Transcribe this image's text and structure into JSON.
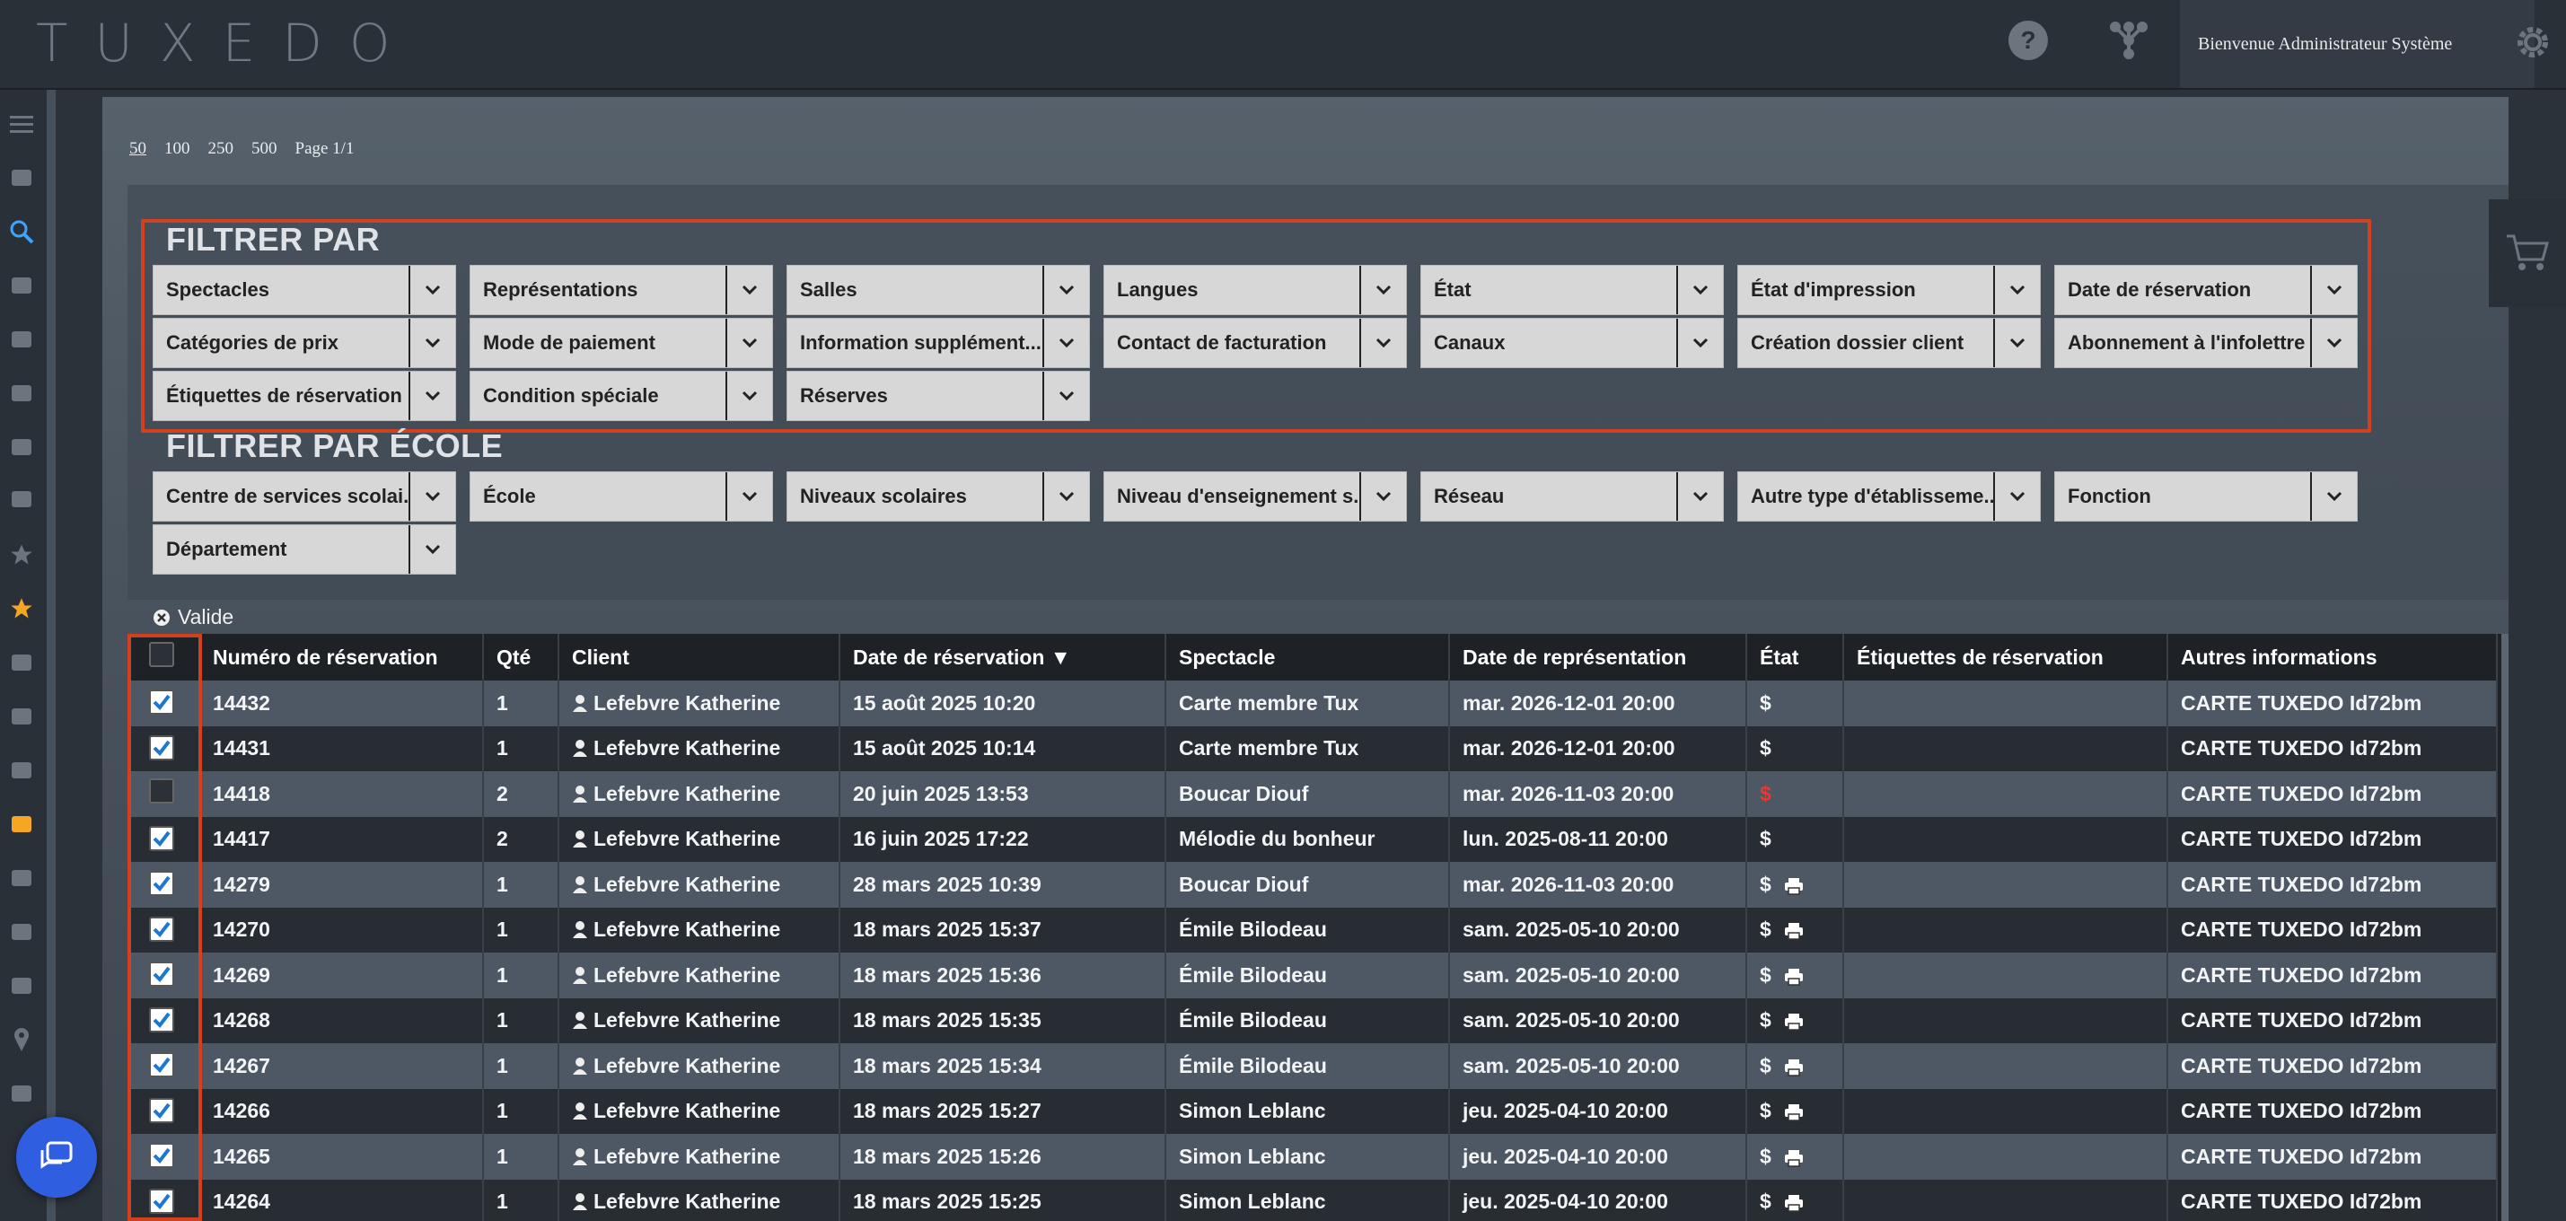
{
  "app": {
    "logo": "TUXEDO",
    "welcome": "Bienvenue Administrateur Système"
  },
  "pagination": {
    "sizes": [
      "50",
      "100",
      "250",
      "500"
    ],
    "page": "Page 1/1"
  },
  "filters": {
    "title": "FILTRER PAR",
    "items": [
      "Spectacles",
      "Représentations",
      "Salles",
      "Langues",
      "État",
      "État d'impression",
      "Date de réservation",
      "Catégories de prix",
      "Mode de paiement",
      "Information supplément...",
      "Contact de facturation",
      "Canaux",
      "Création dossier client",
      "Abonnement à l'infolettre",
      "Étiquettes de réservation",
      "Condition spéciale",
      "Réserves"
    ]
  },
  "school_filters": {
    "title": "FILTRER PAR ÉCOLE",
    "items": [
      "Centre de services scolai...",
      "École",
      "Niveaux scolaires",
      "Niveau d'enseignement s...",
      "Réseau",
      "Autre type d'établisseme...",
      "Fonction",
      "Département"
    ]
  },
  "active_filter": {
    "label": "Valide"
  },
  "table": {
    "headers": [
      "Numéro de réservation",
      "Qté",
      "Client",
      "Date de réservation ▼",
      "Spectacle",
      "Date de représentation",
      "État",
      "Étiquettes de réservation",
      "Autres informations"
    ],
    "rows": [
      {
        "checked": true,
        "num": "14432",
        "qty": "1",
        "client": "Lefebvre Katherine",
        "date": "15 août 2025 10:20",
        "show": "Carte membre Tux",
        "perf": "mar. 2026-12-01 20:00",
        "state": "$",
        "state_red": false,
        "printed": false,
        "tags": "",
        "info": "CARTE TUXEDO Id72bm"
      },
      {
        "checked": true,
        "num": "14431",
        "qty": "1",
        "client": "Lefebvre Katherine",
        "date": "15 août 2025 10:14",
        "show": "Carte membre Tux",
        "perf": "mar. 2026-12-01 20:00",
        "state": "$",
        "state_red": false,
        "printed": false,
        "tags": "",
        "info": "CARTE TUXEDO Id72bm"
      },
      {
        "checked": false,
        "num": "14418",
        "qty": "2",
        "client": "Lefebvre Katherine",
        "date": "20 juin 2025 13:53",
        "show": "Boucar Diouf",
        "perf": "mar. 2026-11-03 20:00",
        "state": "$",
        "state_red": true,
        "printed": false,
        "tags": "",
        "info": "CARTE TUXEDO Id72bm"
      },
      {
        "checked": true,
        "num": "14417",
        "qty": "2",
        "client": "Lefebvre Katherine",
        "date": "16 juin 2025 17:22",
        "show": "Mélodie du bonheur",
        "perf": "lun. 2025-08-11 20:00",
        "state": "$",
        "state_red": false,
        "printed": false,
        "tags": "",
        "info": "CARTE TUXEDO Id72bm"
      },
      {
        "checked": true,
        "num": "14279",
        "qty": "1",
        "client": "Lefebvre Katherine",
        "date": "28 mars 2025 10:39",
        "show": "Boucar Diouf",
        "perf": "mar. 2026-11-03 20:00",
        "state": "$",
        "state_red": false,
        "printed": true,
        "tags": "",
        "info": "CARTE TUXEDO Id72bm"
      },
      {
        "checked": true,
        "num": "14270",
        "qty": "1",
        "client": "Lefebvre Katherine",
        "date": "18 mars 2025 15:37",
        "show": "Émile Bilodeau",
        "perf": "sam. 2025-05-10 20:00",
        "state": "$",
        "state_red": false,
        "printed": true,
        "tags": "",
        "info": "CARTE TUXEDO Id72bm"
      },
      {
        "checked": true,
        "num": "14269",
        "qty": "1",
        "client": "Lefebvre Katherine",
        "date": "18 mars 2025 15:36",
        "show": "Émile Bilodeau",
        "perf": "sam. 2025-05-10 20:00",
        "state": "$",
        "state_red": false,
        "printed": true,
        "tags": "",
        "info": "CARTE TUXEDO Id72bm"
      },
      {
        "checked": true,
        "num": "14268",
        "qty": "1",
        "client": "Lefebvre Katherine",
        "date": "18 mars 2025 15:35",
        "show": "Émile Bilodeau",
        "perf": "sam. 2025-05-10 20:00",
        "state": "$",
        "state_red": false,
        "printed": true,
        "tags": "",
        "info": "CARTE TUXEDO Id72bm"
      },
      {
        "checked": true,
        "num": "14267",
        "qty": "1",
        "client": "Lefebvre Katherine",
        "date": "18 mars 2025 15:34",
        "show": "Émile Bilodeau",
        "perf": "sam. 2025-05-10 20:00",
        "state": "$",
        "state_red": false,
        "printed": true,
        "tags": "",
        "info": "CARTE TUXEDO Id72bm"
      },
      {
        "checked": true,
        "num": "14266",
        "qty": "1",
        "client": "Lefebvre Katherine",
        "date": "18 mars 2025 15:27",
        "show": "Simon Leblanc",
        "perf": "jeu. 2025-04-10 20:00",
        "state": "$",
        "state_red": false,
        "printed": true,
        "tags": "",
        "info": "CARTE TUXEDO Id72bm"
      },
      {
        "checked": true,
        "num": "14265",
        "qty": "1",
        "client": "Lefebvre Katherine",
        "date": "18 mars 2025 15:26",
        "show": "Simon Leblanc",
        "perf": "jeu. 2025-04-10 20:00",
        "state": "$",
        "state_red": false,
        "printed": true,
        "tags": "",
        "info": "CARTE TUXEDO Id72bm"
      },
      {
        "checked": true,
        "num": "14264",
        "qty": "1",
        "client": "Lefebvre Katherine",
        "date": "18 mars 2025 15:25",
        "show": "Simon Leblanc",
        "perf": "jeu. 2025-04-10 20:00",
        "state": "$",
        "state_red": false,
        "printed": true,
        "tags": "",
        "info": "CARTE TUXEDO Id72bm"
      }
    ]
  },
  "colors": {
    "highlight": "#d2411f",
    "accent_blue": "#2f5fe0",
    "state_red": "#e53935",
    "star_orange": "#f5a623"
  },
  "sidebar_icons": [
    "menu-icon",
    "ticket-icon",
    "search-icon",
    "target-icon",
    "users-icon",
    "wand-icon",
    "tags-icon",
    "send-icon",
    "star-icon",
    "star-filled-icon",
    "hand-heart-icon",
    "id-card-icon",
    "price-tag-icon",
    "price-tag-filled-icon",
    "mobile-icon",
    "tools-icon",
    "signpost-icon",
    "map-pin-icon",
    "briefcase-icon"
  ]
}
